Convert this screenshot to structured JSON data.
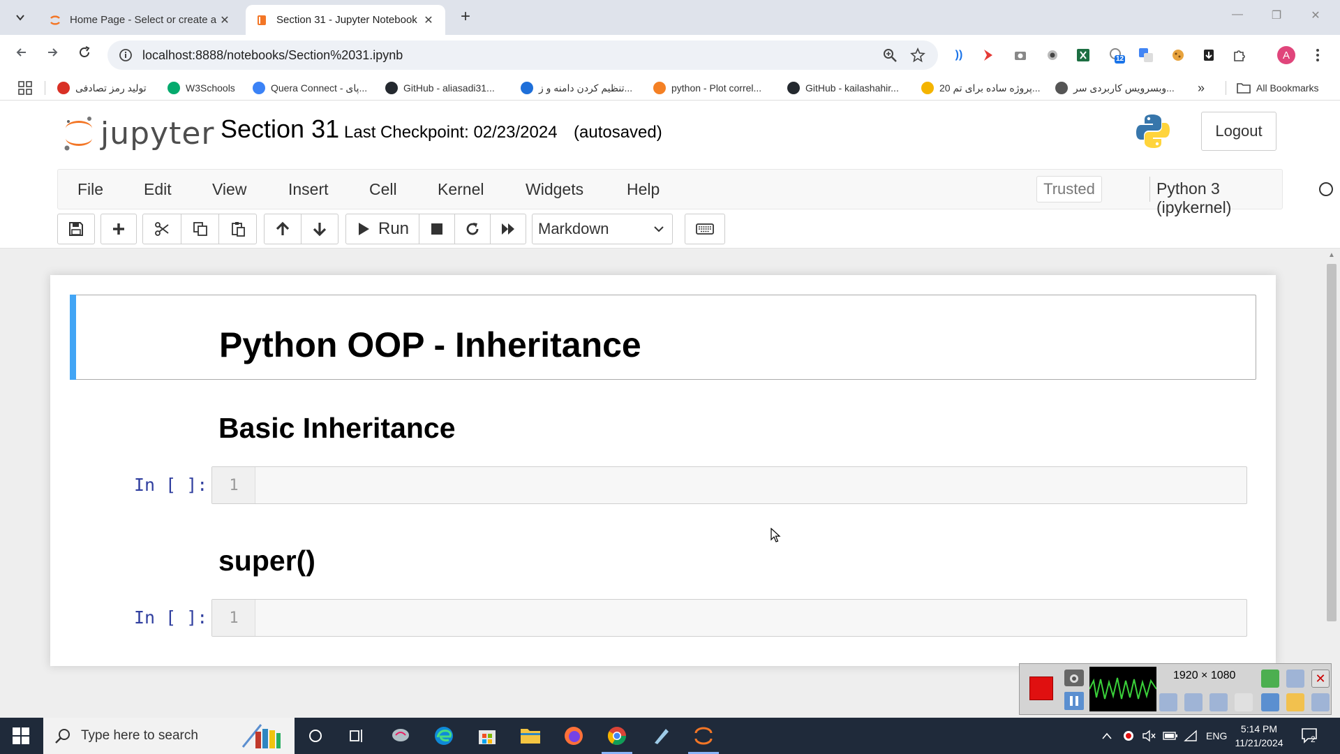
{
  "browser": {
    "tabs": [
      {
        "title": "Home Page - Select or create a notebook",
        "active": false
      },
      {
        "title": "Section 31 - Jupyter Notebook",
        "active": true
      }
    ],
    "url": "localhost:8888/notebooks/Section%2031.ipynb",
    "bookmarks": [
      {
        "label": "تولید رمز تصادفی",
        "color": "#d93025",
        "icon": "briefcase-icon"
      },
      {
        "label": "W3Schools",
        "color": "#04aa6d",
        "icon": "w3schools-icon"
      },
      {
        "label": "Quera Connect - پای...",
        "color": "#3b82f6",
        "icon": "quera-icon"
      },
      {
        "label": "GitHub - aliasadi31...",
        "color": "#24292f",
        "icon": "github-icon"
      },
      {
        "label": "تنظیم کردن دامنه و ز...",
        "color": "#1e6fd9",
        "icon": "globe-icon"
      },
      {
        "label": "python - Plot correl...",
        "color": "#f48024",
        "icon": "stackoverflow-icon"
      },
      {
        "label": "GitHub - kailashahir...",
        "color": "#24292f",
        "icon": "github-icon"
      },
      {
        "label": "20 پروژه ساده برای تم...",
        "color": "#f4b400",
        "icon": "sun-icon"
      },
      {
        "label": "وبسرویس کاربردی سر...",
        "color": "#555555",
        "icon": "globe-icon"
      }
    ],
    "all_bookmarks": "All Bookmarks",
    "more_bookmarks": "»",
    "extension_badge": "12",
    "profile_initial": "A"
  },
  "jupyter": {
    "logo_text": "jupyter",
    "notebook_name": "Section 31",
    "checkpoint": "Last Checkpoint: 02/23/2024",
    "autosave": "(autosaved)",
    "logout": "Logout",
    "menu": [
      "File",
      "Edit",
      "View",
      "Insert",
      "Cell",
      "Kernel",
      "Widgets",
      "Help"
    ],
    "trusted": "Trusted",
    "kernel": "Python 3 (ipykernel)",
    "toolbar": {
      "run_label": "Run",
      "cell_type": "Markdown"
    }
  },
  "cells": {
    "h1": "Python OOP - Inheritance",
    "h2_basic": "Basic Inheritance",
    "h2_super": "super()",
    "prompt": "In [ ]:",
    "line_number": "1"
  },
  "recorder": {
    "resolution": "1920 × 1080"
  },
  "taskbar": {
    "search_placeholder": "Type here to search",
    "lang": "ENG",
    "time": "5:14 PM",
    "date": "11/21/2024",
    "notif_count": "2"
  },
  "colors": {
    "jupyter_orange": "#f37626",
    "selected_cell": "#42a5f5",
    "prompt_blue": "#303f9f",
    "recorder_red": "#e01010"
  }
}
